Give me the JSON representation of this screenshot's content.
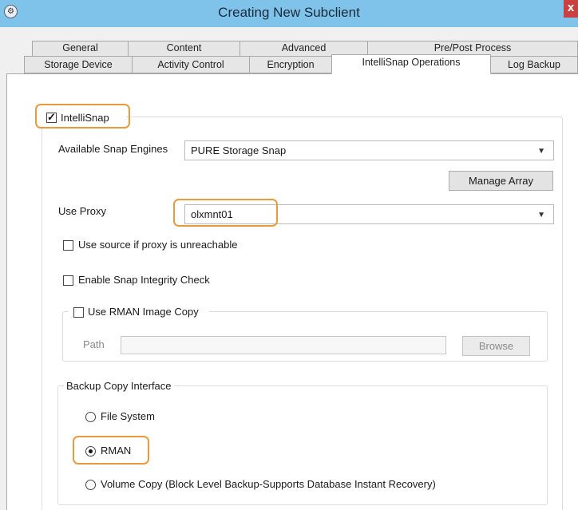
{
  "window": {
    "title": "Creating New Subclient",
    "close_glyph": "x"
  },
  "tabs": {
    "row1": [
      {
        "label": "General"
      },
      {
        "label": "Content"
      },
      {
        "label": "Advanced"
      },
      {
        "label": "Pre/Post Process"
      }
    ],
    "row2": [
      {
        "label": "Storage Device"
      },
      {
        "label": "Activity Control"
      },
      {
        "label": "Encryption"
      },
      {
        "label": "IntelliSnap Operations",
        "selected": true
      },
      {
        "label": "Log Backup"
      }
    ]
  },
  "intellisnap": {
    "checkbox_label": "IntelliSnap",
    "checked": true,
    "snap_engines_label": "Available Snap Engines",
    "snap_engine_value": "PURE Storage Snap",
    "manage_array_label": "Manage Array",
    "use_proxy_label": "Use Proxy",
    "proxy_value": "olxmnt01",
    "use_source_label": "Use source if proxy is unreachable",
    "use_source_checked": false,
    "integrity_check_label": "Enable Snap Integrity Check",
    "integrity_check_checked": false,
    "rman_image_copy_label": "Use RMAN Image Copy",
    "rman_image_copy_checked": false,
    "path_label": "Path",
    "path_value": "",
    "browse_label": "Browse"
  },
  "backup_copy_interface": {
    "group_label": "Backup Copy Interface",
    "options": [
      {
        "label": "File System",
        "selected": false
      },
      {
        "label": "RMAN",
        "selected": true
      },
      {
        "label": "Volume Copy (Block Level Backup-Supports Database Instant Recovery)",
        "selected": false
      }
    ]
  },
  "colors": {
    "titlebar": "#7fc2ea",
    "highlight": "#e89a3c",
    "close": "#c94040"
  }
}
